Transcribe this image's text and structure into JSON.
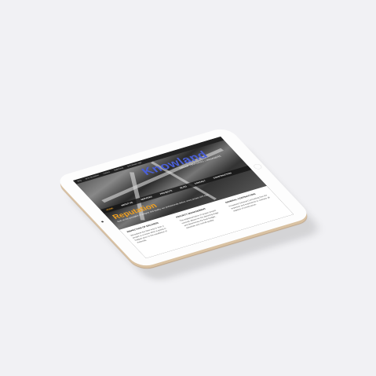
{
  "topbar": {
    "links": [
      "Blog",
      "BCS Newsletter",
      "Careers",
      "Staff Portal",
      "BCS Email Login"
    ]
  },
  "logo": {
    "text": "Knowland",
    "tagline": "GROUP | BUILDERS | MANAGERS"
  },
  "nav": {
    "items": [
      "HOME",
      "ABOUT US",
      "SERVICES",
      "PROJECTS",
      "BLOG",
      "CONTACT",
      "CONSTRUCTION"
    ]
  },
  "hero": {
    "title": "Reputation",
    "text": "Built on the principles of integrity and quality, our professionals deliver every project with care."
  },
  "columns": [
    {
      "title": "INSPECTION OF RECORDS",
      "text": "We believe the best way to start a project is to know what is going to happen prior to the installation of materials."
    },
    {
      "title": "PROJECT MANAGEMENT",
      "text": "The implementation of proper project controls allows for the planning stage and determines the final budget, schedule and overall quality."
    },
    {
      "title": "GENERAL CONTRACTING",
      "text": "Knowland General Contracting has the expertise and experience to oversee all aspects of construction."
    }
  ]
}
